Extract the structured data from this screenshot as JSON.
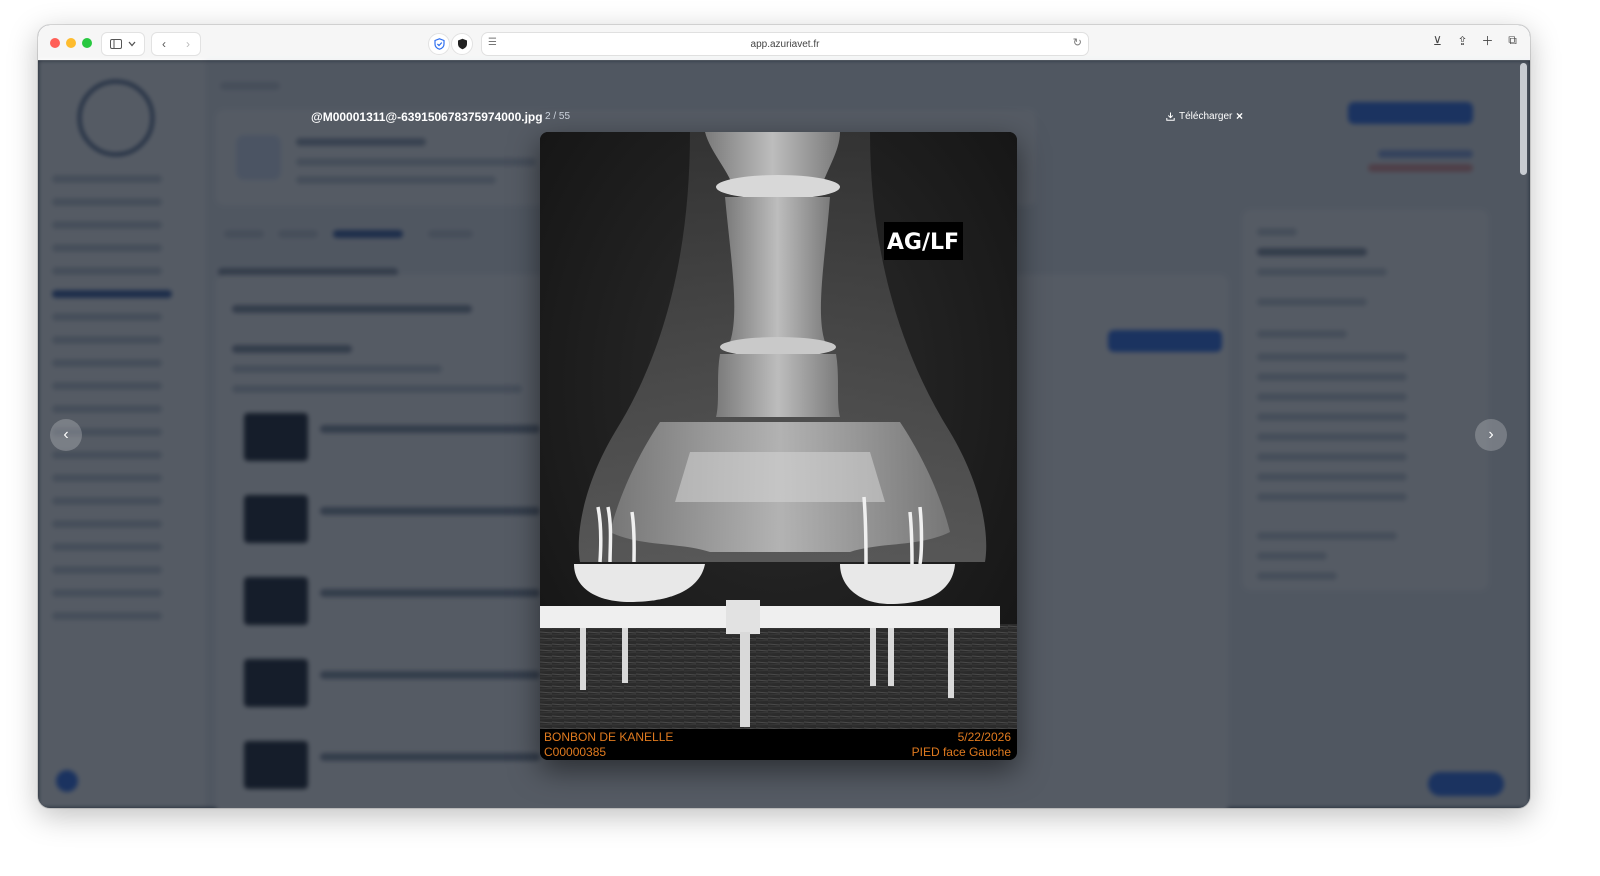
{
  "browser": {
    "url": "app.azuriavet.fr"
  },
  "viewer": {
    "filename": "@M00001311@-639150678375974000.jpg",
    "position": "2 / 55",
    "download_label": "Télécharger",
    "close_symbol": "×",
    "prev_symbol": "‹",
    "next_symbol": "›"
  },
  "xray": {
    "marker_label": "AG/LF",
    "patient_name": "BONBON DE KANELLE",
    "patient_id": "C00000385",
    "date": "5/22/2026",
    "view_label": "PIED face Gauche"
  },
  "colors": {
    "overlay": "#141c28",
    "annotation_orange": "#e07a1f",
    "accent_blue": "#2f6ff0"
  }
}
